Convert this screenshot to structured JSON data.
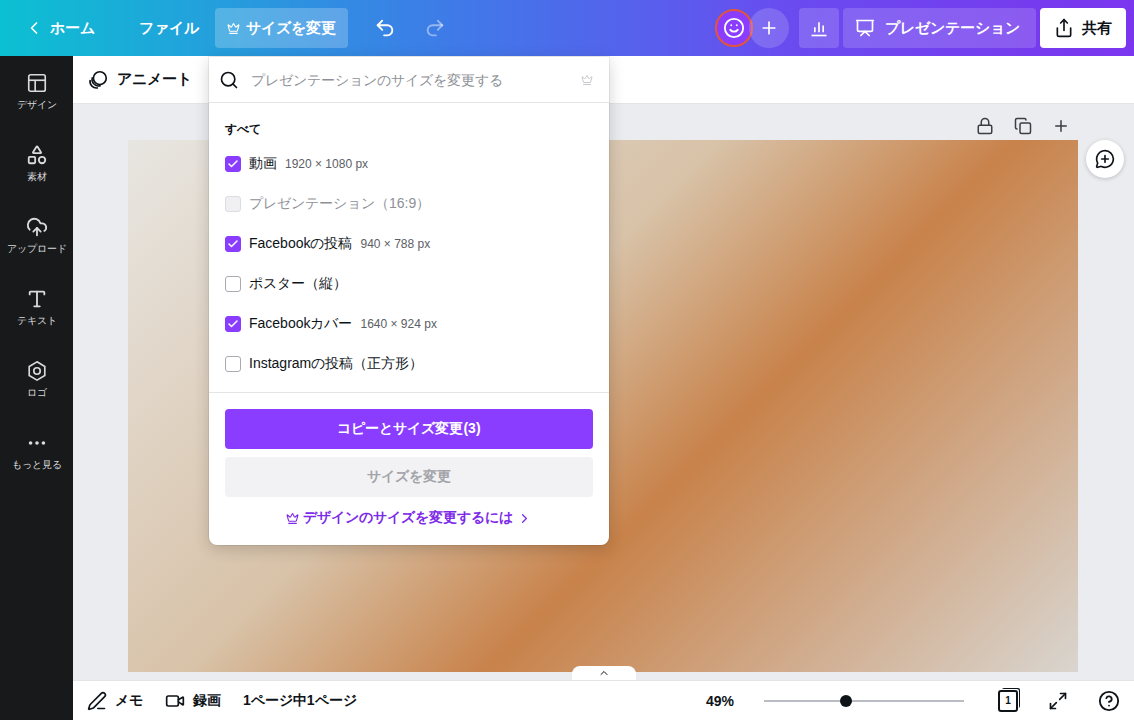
{
  "top_bar": {
    "back": "ホーム",
    "file": "ファイル",
    "resize": {
      "label": "サイズを変更",
      "selected": true
    },
    "undo": {
      "disabled": false
    },
    "redo": {
      "disabled": true
    },
    "present": "プレゼンテーション",
    "share": "共有"
  },
  "sidebar": {
    "items": [
      {
        "label": "デザイン"
      },
      {
        "label": "素材"
      },
      {
        "label": "アップロード"
      },
      {
        "label": "テキスト"
      },
      {
        "label": "ロゴ"
      },
      {
        "label": "もっと見る"
      }
    ]
  },
  "toolbar": {
    "animate": "アニメート"
  },
  "resize_menu": {
    "search_placeholder": "プレゼンテーションのサイズを変更する",
    "section": "すべて",
    "options": [
      {
        "label": "動画",
        "size": "1920 × 1080 px",
        "checked": true,
        "disabled": false
      },
      {
        "label": "プレゼンテーション（16:9）",
        "checked": false,
        "disabled": true
      },
      {
        "label": "Facebookの投稿",
        "size": "940 × 788 px",
        "checked": true,
        "disabled": false
      },
      {
        "label": "ポスター（縦）",
        "checked": false,
        "disabled": false
      },
      {
        "label": "Facebookカバー",
        "size": "1640 × 924 px",
        "checked": true,
        "disabled": false
      },
      {
        "label": "Instagramの投稿（正方形）",
        "checked": false,
        "disabled": false
      }
    ],
    "primary_button": "コピーとサイズ変更(3)",
    "secondary_button": {
      "label": "サイズを変更",
      "disabled": true
    },
    "link": "デザインのサイズを変更するには"
  },
  "bottom_bar": {
    "notes": "メモ",
    "record": "録画",
    "pages": "1ページ中1ページ",
    "zoom": "49%",
    "zoom_level": 0.41,
    "page_count": "1"
  }
}
